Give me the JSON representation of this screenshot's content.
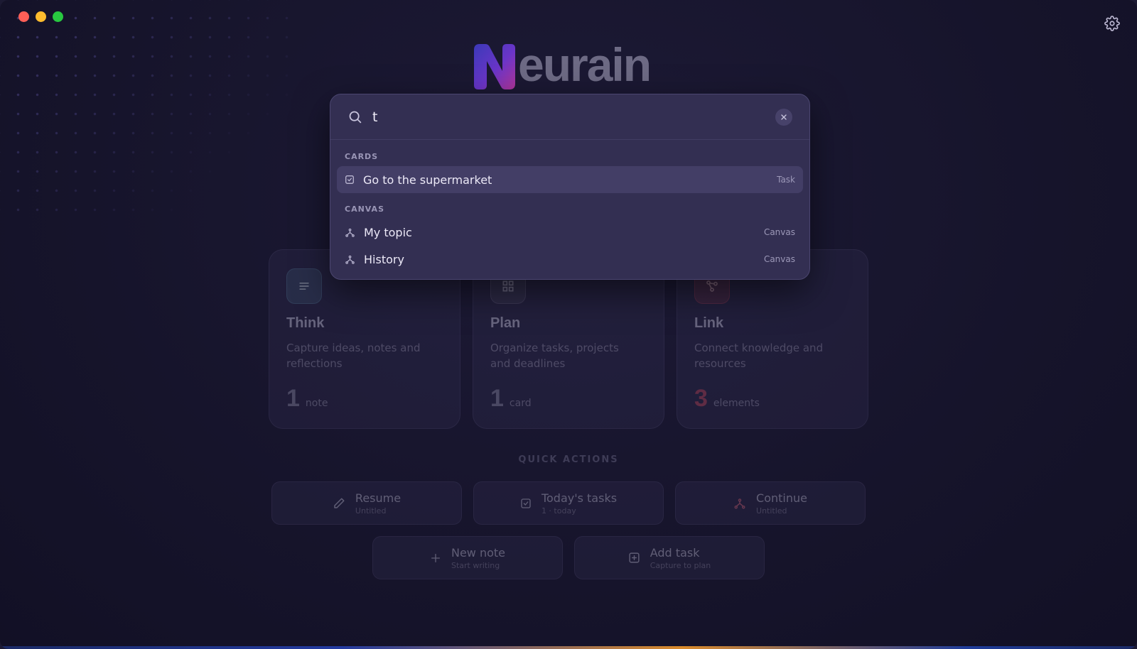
{
  "window": {
    "controls": [
      "close",
      "minimize",
      "maximize"
    ]
  },
  "brand": {
    "logo_text": "eurain",
    "logo_letter": "N"
  },
  "header": {
    "settings_icon": "gear-icon"
  },
  "modules": [
    {
      "title": "Think",
      "description": "Capture ideas, notes and reflections",
      "count": "1",
      "unit": "note",
      "icon": "lines-icon",
      "color": "#5e8ba8"
    },
    {
      "title": "Plan",
      "description": "Organize tasks, projects and deadlines",
      "count": "1",
      "unit": "card",
      "icon": "grid-icon",
      "color": "#7a7690"
    },
    {
      "title": "Link",
      "description": "Connect knowledge and resources",
      "count": "3",
      "unit": "elements",
      "icon": "share-icon",
      "color": "#b8485f"
    }
  ],
  "quick_actions": {
    "title": "QUICK ACTIONS",
    "items": [
      {
        "label": "Resume",
        "sub": "Untitled",
        "icon": "pencil-icon"
      },
      {
        "label": "Today's tasks",
        "sub": "1 · today",
        "icon": "checkbox-icon"
      },
      {
        "label": "Continue",
        "sub": "Untitled",
        "icon": "fork-icon"
      },
      {
        "label": "New note",
        "sub": "Start writing",
        "icon": "plus-icon"
      },
      {
        "label": "Add task",
        "sub": "Capture to plan",
        "icon": "plus-square-icon"
      }
    ]
  },
  "palette": {
    "query": "t",
    "sections": [
      {
        "label": "CARDS",
        "results": [
          {
            "label": "Go to the supermarket",
            "type": "Task",
            "icon": "checkbox-icon"
          }
        ]
      },
      {
        "label": "CANVAS",
        "results": [
          {
            "label": "My topic",
            "type": "Canvas",
            "icon": "fork-icon"
          },
          {
            "label": "History",
            "type": "Canvas",
            "icon": "fork-icon"
          }
        ]
      }
    ]
  }
}
